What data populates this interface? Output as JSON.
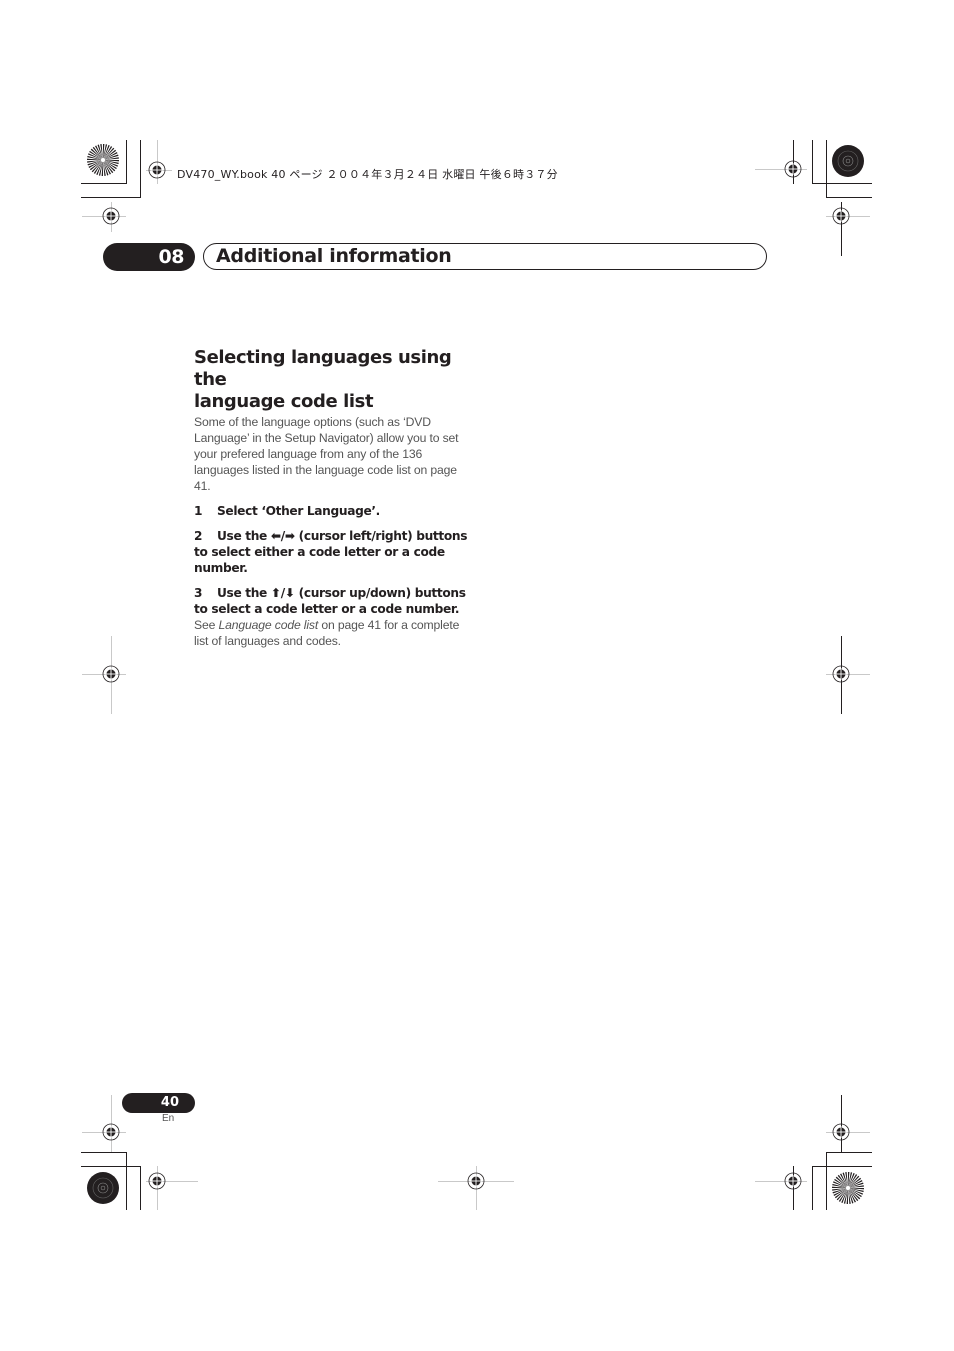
{
  "print_header": {
    "text": "DV470_WY.book  40 ページ  ２００４年３月２４日  水曜日  午後６時３７分"
  },
  "chapter": {
    "number": "08",
    "title": "Additional information"
  },
  "section": {
    "heading_line1": "Selecting languages using the",
    "heading_line2": "language code list",
    "intro": "Some of the language options (such as ‘DVD Language’ in the Setup Navigator) allow you to set your prefered language from any of the 136 languages listed in the language code list on page 41.",
    "steps": [
      {
        "number": "1",
        "text": "Select ‘Other Language’."
      },
      {
        "number": "2",
        "prefix": "Use the ",
        "arrows": "⬅/➡",
        "text": " (cursor left/right) buttons to select either a code letter or a code number."
      },
      {
        "number": "3",
        "prefix": "Use the ",
        "arrows": "⬆/⬇",
        "text": " (cursor up/down) buttons to select a code letter or a code number."
      }
    ],
    "note_prefix": "See ",
    "note_link": "Language code list",
    "note_suffix": " on page 41 for a complete list of languages and codes."
  },
  "footer": {
    "page_number": "40",
    "language": "En"
  },
  "icons": {
    "registration_mark": "registration-mark",
    "starburst": "color-starburst-target"
  }
}
